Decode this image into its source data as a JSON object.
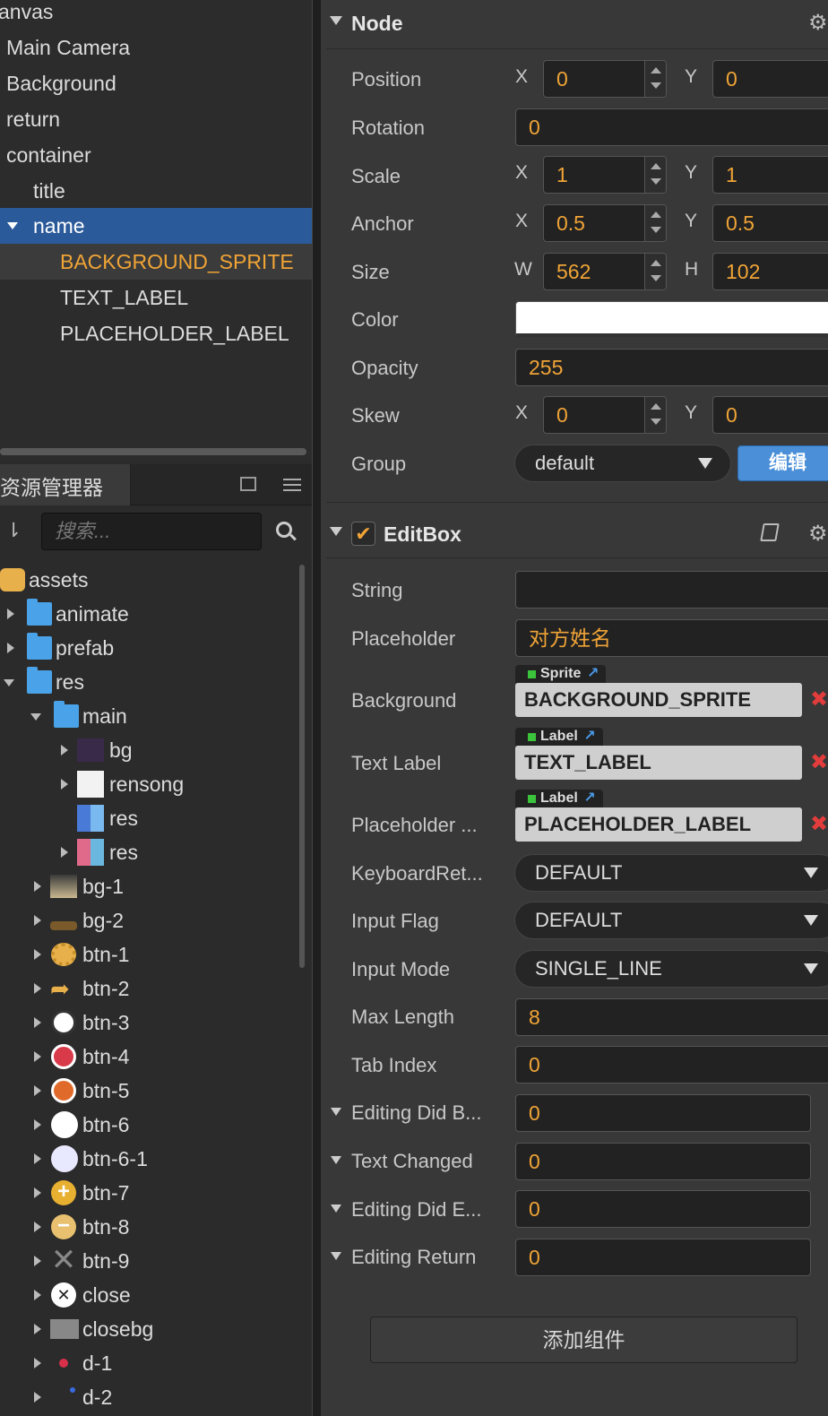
{
  "hierarchy": {
    "items": [
      {
        "label": "anvas",
        "indent": 0
      },
      {
        "label": "Main Camera",
        "indent": 1
      },
      {
        "label": "Background",
        "indent": 1
      },
      {
        "label": "return",
        "indent": 1
      },
      {
        "label": "container",
        "indent": 1
      },
      {
        "label": "title",
        "indent": 2
      },
      {
        "label": "name",
        "indent": 2
      },
      {
        "label": "BACKGROUND_SPRITE",
        "indent": 3
      },
      {
        "label": "TEXT_LABEL",
        "indent": 3
      },
      {
        "label": "PLACEHOLDER_LABEL",
        "indent": 3
      }
    ]
  },
  "assets_panel": {
    "tab_label": "资源管理器",
    "search_placeholder": "搜索...",
    "items": [
      {
        "label": "assets",
        "icon": "asset-root-icon"
      },
      {
        "label": "animate",
        "icon": "folder-icon"
      },
      {
        "label": "prefab",
        "icon": "folder-icon"
      },
      {
        "label": "res",
        "icon": "folder-icon"
      },
      {
        "label": "main",
        "icon": "folder-icon"
      },
      {
        "label": "bg",
        "icon": "image-thumbnail-icon"
      },
      {
        "label": "rensong",
        "icon": "image-thumbnail-icon"
      },
      {
        "label": "res",
        "icon": "atlas-icon"
      },
      {
        "label": "res",
        "icon": "atlas-icon"
      },
      {
        "label": "bg-1",
        "icon": "crown-icon"
      },
      {
        "label": "bg-2",
        "icon": "image-thumbnail-icon"
      },
      {
        "label": "btn-1",
        "icon": "gear-button-icon"
      },
      {
        "label": "btn-2",
        "icon": "share-arrow-icon"
      },
      {
        "label": "btn-3",
        "icon": "round-button-icon"
      },
      {
        "label": "btn-4",
        "icon": "round-button-icon"
      },
      {
        "label": "btn-5",
        "icon": "round-button-icon"
      },
      {
        "label": "btn-6",
        "icon": "circle-icon"
      },
      {
        "label": "btn-6-1",
        "icon": "circle-icon"
      },
      {
        "label": "btn-7",
        "icon": "plus-circle-icon"
      },
      {
        "label": "btn-8",
        "icon": "minus-circle-icon"
      },
      {
        "label": "btn-9",
        "icon": "x-icon"
      },
      {
        "label": "close",
        "icon": "close-circle-icon"
      },
      {
        "label": "closebg",
        "icon": "image-thumbnail-icon"
      },
      {
        "label": "d-1",
        "icon": "dot-icon"
      },
      {
        "label": "d-2",
        "icon": "dot-icon"
      }
    ]
  },
  "node": {
    "title": "Node",
    "position": {
      "label": "Position",
      "x": "0",
      "y": "0"
    },
    "rotation": {
      "label": "Rotation",
      "value": "0"
    },
    "scale": {
      "label": "Scale",
      "x": "1",
      "y": "1"
    },
    "anchor": {
      "label": "Anchor",
      "x": "0.5",
      "y": "0.5"
    },
    "size": {
      "label": "Size",
      "w": "562",
      "h": "102"
    },
    "color": {
      "label": "Color",
      "value": "#ffffff"
    },
    "opacity": {
      "label": "Opacity",
      "value": "255"
    },
    "skew": {
      "label": "Skew",
      "x": "0",
      "y": "0"
    },
    "group": {
      "label": "Group",
      "value": "default",
      "edit_label": "编辑"
    },
    "axis": {
      "x": "X",
      "y": "Y",
      "w": "W",
      "h": "H"
    }
  },
  "editbox": {
    "title": "EditBox",
    "enabled": true,
    "string": {
      "label": "String",
      "value": ""
    },
    "placeholder": {
      "label": "Placeholder",
      "value": "对方姓名"
    },
    "background": {
      "label": "Background",
      "type": "Sprite",
      "value": "BACKGROUND_SPRITE"
    },
    "text_label": {
      "label": "Text Label",
      "type": "Label",
      "value": "TEXT_LABEL"
    },
    "placeholder_label": {
      "label": "Placeholder ...",
      "type": "Label",
      "value": "PLACEHOLDER_LABEL"
    },
    "keyboard_return": {
      "label": "KeyboardRet...",
      "value": "DEFAULT"
    },
    "input_flag": {
      "label": "Input Flag",
      "value": "DEFAULT"
    },
    "input_mode": {
      "label": "Input Mode",
      "value": "SINGLE_LINE"
    },
    "max_length": {
      "label": "Max Length",
      "value": "8"
    },
    "tab_index": {
      "label": "Tab Index",
      "value": "0"
    },
    "events": [
      {
        "label": "Editing Did B...",
        "value": "0"
      },
      {
        "label": "Text Changed",
        "value": "0"
      },
      {
        "label": "Editing Did E...",
        "value": "0"
      },
      {
        "label": "Editing Return",
        "value": "0"
      }
    ]
  },
  "add_component_label": "添加组件",
  "colors": {
    "accent": "#f0a436",
    "selection": "#2b5a9a",
    "edit_button": "#4a8fd8",
    "remove": "#e23c3c"
  }
}
